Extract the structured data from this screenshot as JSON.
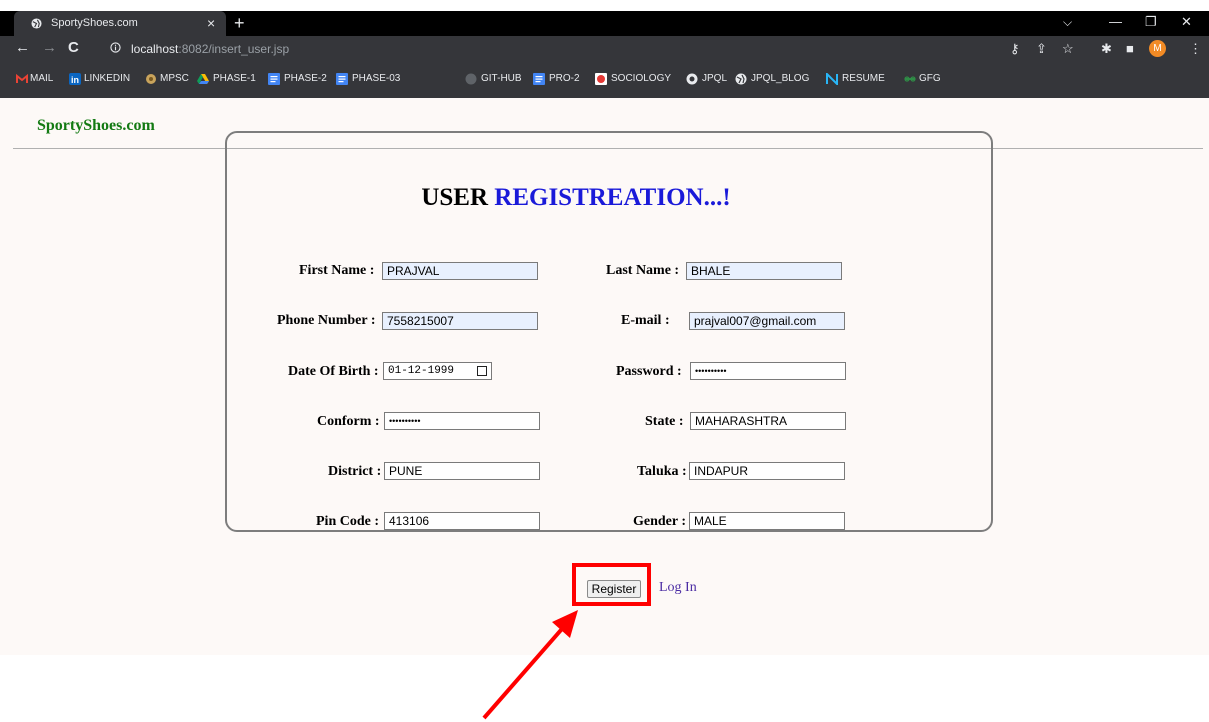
{
  "browser": {
    "tab_title": "SportyShoes.com",
    "tab_close": "×",
    "new_tab": "+",
    "url_host": "localhost",
    "url_rest": ":8082/insert_user.jsp",
    "avatar_letter": "M",
    "bookmarks": [
      "MAIL",
      "LINKEDIN",
      "MPSC",
      "PHASE-1",
      "PHASE-2",
      "PHASE-03",
      "GIT-HUB",
      "PRO-2",
      "SOCIOLOGY",
      "JPQL",
      "JPQL_BLOG",
      "RESUME",
      "GFG"
    ]
  },
  "page": {
    "brand": "SportyShoes.com",
    "heading_black": "USER ",
    "heading_blue": "REGISTREATION...!"
  },
  "form": {
    "first_name_label": "First Name :",
    "first_name_value": "PRAJVAL",
    "last_name_label": "Last Name :",
    "last_name_value": "BHALE",
    "phone_label": "Phone Number :",
    "phone_value": "7558215007",
    "email_label": "E-mail :",
    "email_value": "prajval007@gmail.com",
    "dob_label": "Date Of Birth :",
    "dob_value": "01-12-1999",
    "password_label": "Password :",
    "password_value": "••••••••••",
    "confirm_label": "Conform :",
    "confirm_value": "••••••••••",
    "state_label": "State :",
    "state_value": "MAHARASHTRA",
    "district_label": "District :",
    "district_value": "PUNE",
    "taluka_label": "Taluka :",
    "taluka_value": "INDAPUR",
    "pincode_label": "Pin Code :",
    "pincode_value": "413106",
    "gender_label": "Gender :",
    "gender_value": "MALE",
    "register_label": "Register",
    "login_label": "Log In"
  },
  "colors": {
    "brand": "#137a13",
    "heading_blue": "#1a1ad9",
    "highlight": "#ff0000",
    "link": "#4b2ca3"
  }
}
